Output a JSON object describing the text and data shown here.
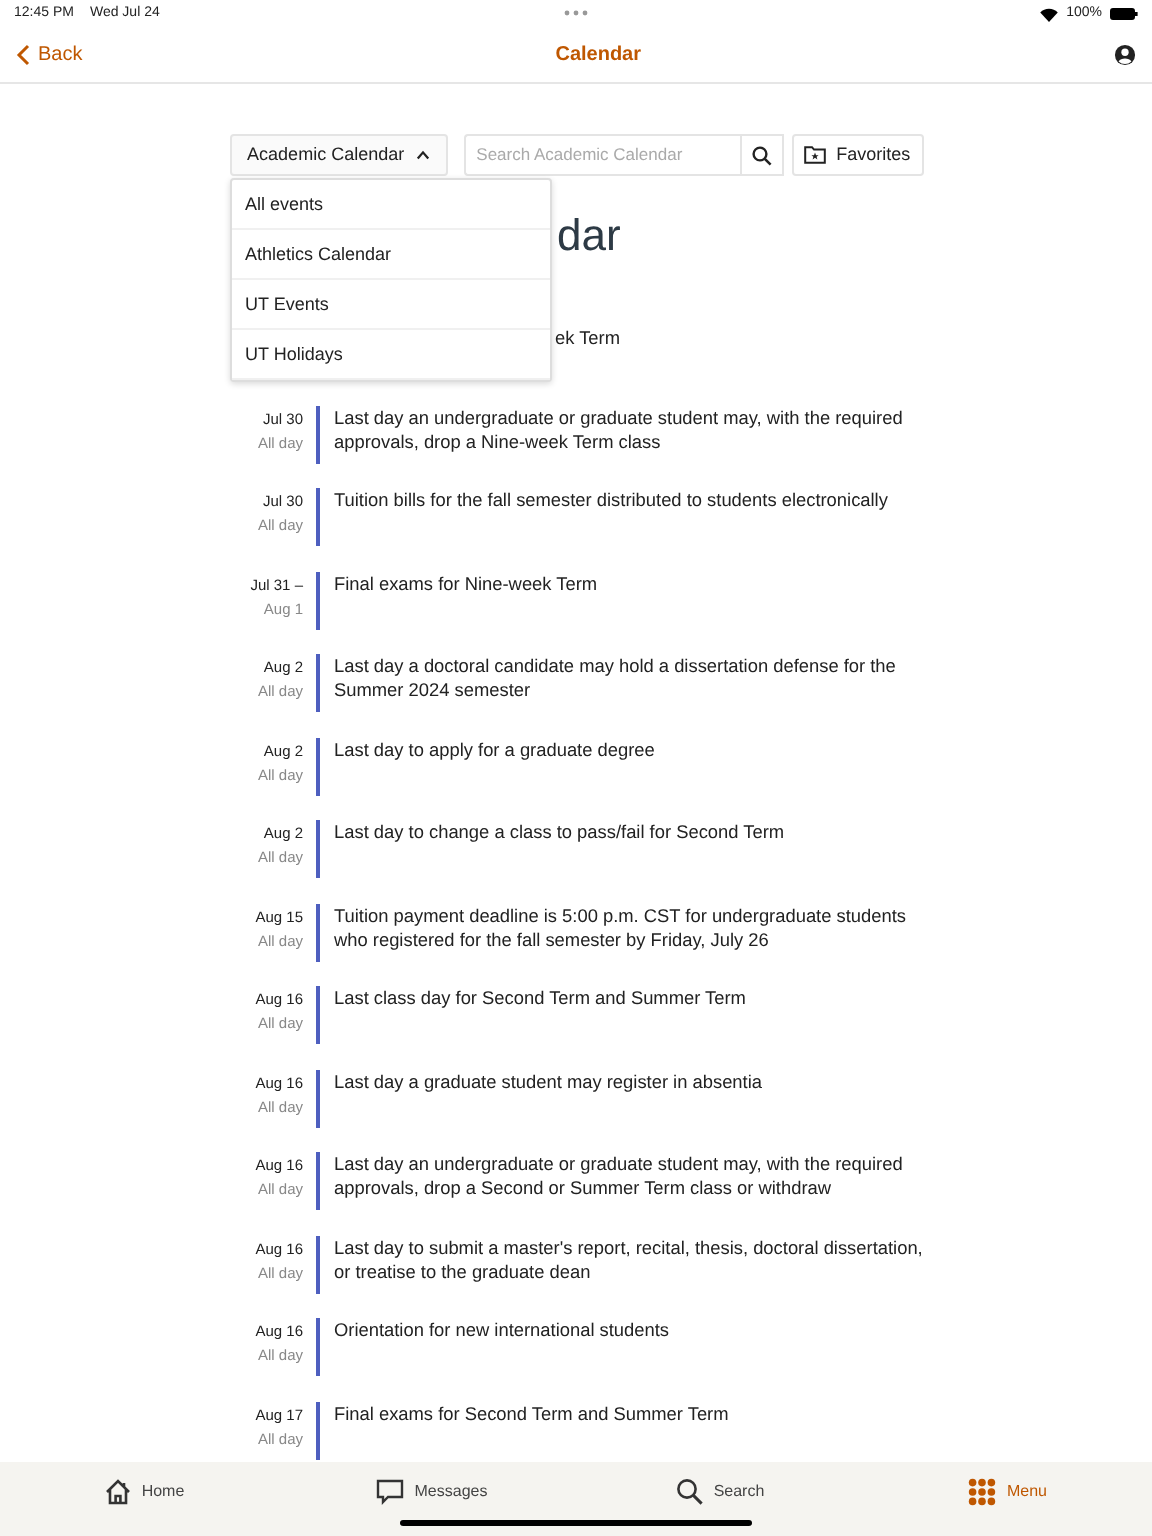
{
  "status_bar": {
    "time": "12:45 PM",
    "date": "Wed Jul 24",
    "battery": "100%"
  },
  "nav": {
    "back": "Back",
    "title": "Calendar"
  },
  "toolbar": {
    "calendar_select": {
      "label": "Academic Calendar",
      "expanded": true
    },
    "search": {
      "placeholder": "Search Academic Calendar"
    },
    "favorites": "Favorites"
  },
  "dropdown": [
    "All events",
    "Athletics Calendar",
    "UT Events",
    "UT Holidays"
  ],
  "heading": "dar",
  "partial_event": {
    "title": "ek Term"
  },
  "events": [
    {
      "date": "Jul 30",
      "time": "All day",
      "title": "Last day an undergraduate or graduate student may, with the required approvals, drop a Nine-week Term class"
    },
    {
      "date": "Jul 30",
      "time": "All day",
      "title": "Tuition bills for the fall semester distributed to students electronically"
    },
    {
      "date": "Jul 31 –",
      "time": "Aug 1",
      "title": "Final exams for Nine-week Term"
    },
    {
      "date": "Aug 2",
      "time": "All day",
      "title": "Last day a doctoral candidate may hold a dissertation defense for the Summer 2024 semester"
    },
    {
      "date": "Aug 2",
      "time": "All day",
      "title": "Last day to apply for a graduate degree"
    },
    {
      "date": "Aug 2",
      "time": "All day",
      "title": "Last day to change a class to pass/fail for Second Term"
    },
    {
      "date": "Aug 15",
      "time": "All day",
      "title": "Tuition payment deadline is 5:00 p.m. CST for undergraduate students who registered for the fall semester by Friday, July 26"
    },
    {
      "date": "Aug 16",
      "time": "All day",
      "title": "Last class day for Second Term and Summer Term"
    },
    {
      "date": "Aug 16",
      "time": "All day",
      "title": "Last day a graduate student may register in absentia"
    },
    {
      "date": "Aug 16",
      "time": "All day",
      "title": "Last day an undergraduate or graduate student may, with the required approvals, drop a Second or Summer Term class or withdraw"
    },
    {
      "date": "Aug 16",
      "time": "All day",
      "title": "Last day to submit a master's report, recital, thesis, doctoral dissertation, or treatise to the graduate dean"
    },
    {
      "date": "Aug 16",
      "time": "All day",
      "title": "Orientation for new international students"
    },
    {
      "date": "Aug 17",
      "time": "All day",
      "title": "Final exams for Second Term and Summer Term"
    }
  ],
  "tab_bar": [
    {
      "label": "Home",
      "selected": false
    },
    {
      "label": "Messages",
      "selected": false
    },
    {
      "label": "Search",
      "selected": false
    },
    {
      "label": "Menu",
      "selected": true
    }
  ]
}
